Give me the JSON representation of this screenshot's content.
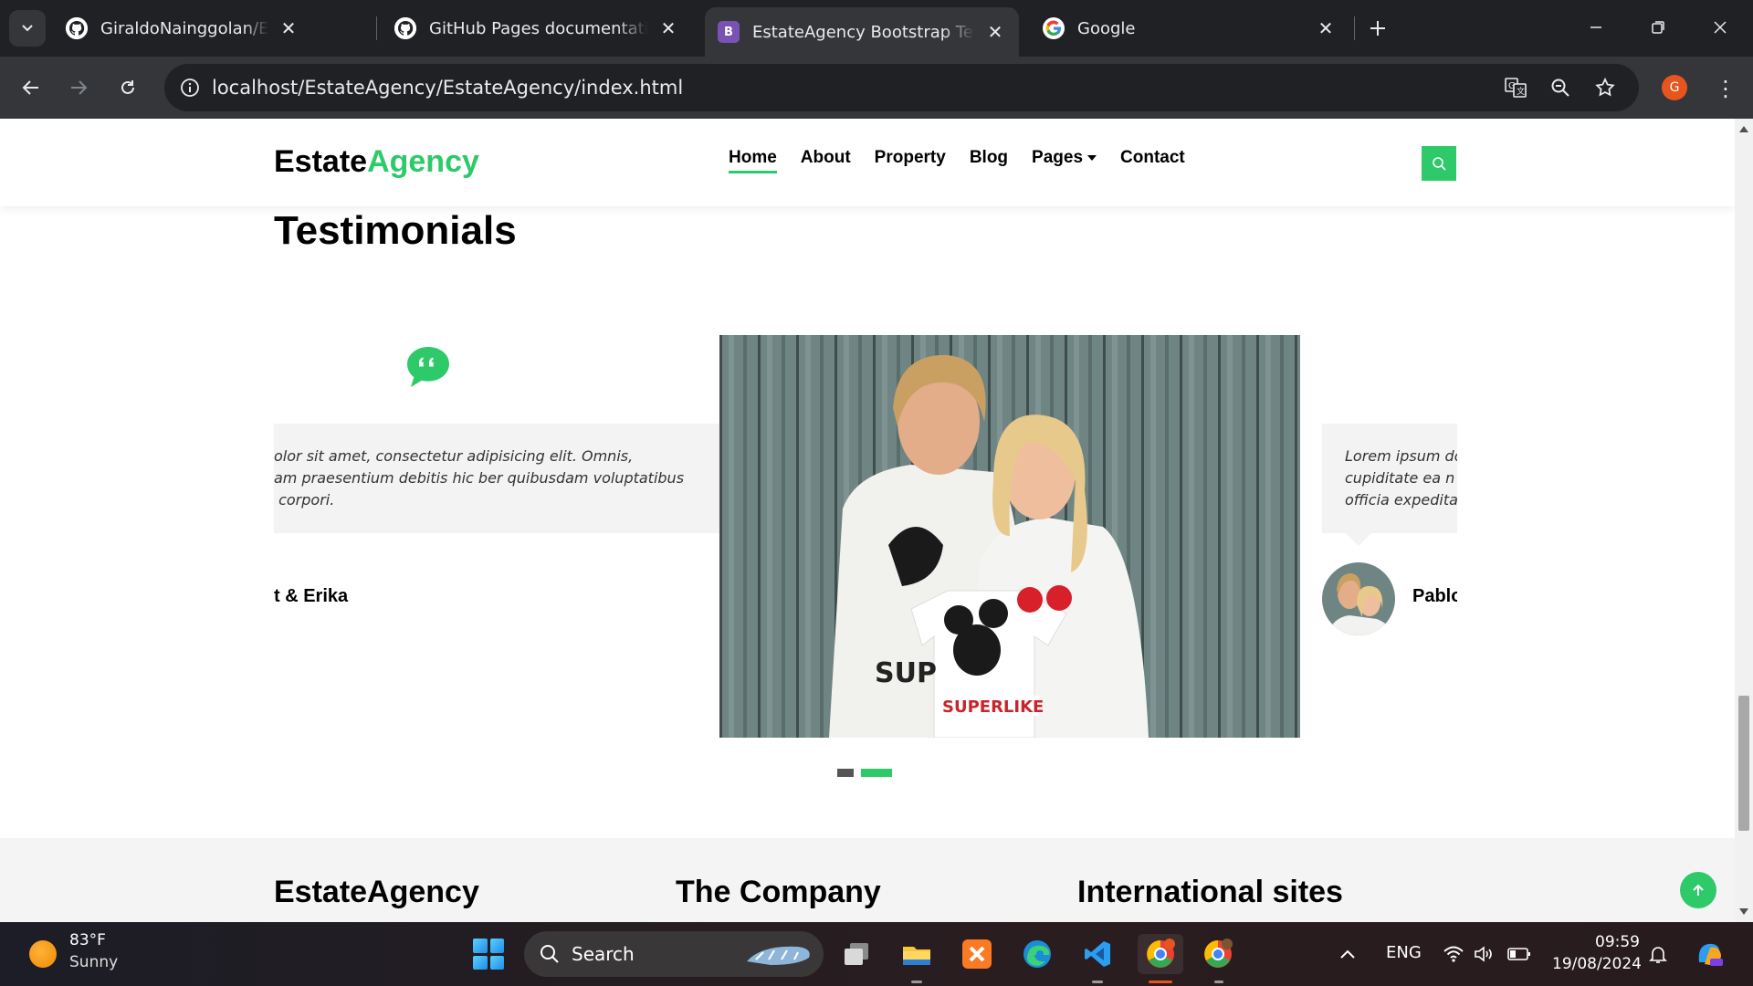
{
  "browser": {
    "tabs": [
      {
        "title": "GiraldoNainggolan/EstateAgency",
        "favicon": "github-icon",
        "active": false
      },
      {
        "title": "GitHub Pages documentation - GitHub Docs",
        "favicon": "github-icon",
        "active": false
      },
      {
        "title": "EstateAgency Bootstrap Template",
        "favicon": "bootstrap-icon",
        "active": true
      },
      {
        "title": "Google",
        "favicon": "google-icon",
        "active": false
      }
    ],
    "url": "localhost/EstateAgency/EstateAgency/index.html",
    "profile_initial": "G"
  },
  "site": {
    "logo": {
      "part1": "Estate",
      "part2": "Agency"
    },
    "accent_color": "#2eca6a",
    "nav": [
      "Home",
      "About",
      "Property",
      "Blog",
      "Pages",
      "Contact"
    ],
    "active_nav": "Home"
  },
  "testimonials": {
    "title": "Testimonials",
    "left_text": "olor sit amet, consectetur adipisicing elit. Omnis,\nam praesentium debitis hic ber quibusdam voluptatibus\n corpori.",
    "left_author": "t & Erika",
    "right_text": "Lorem ipsum do\ncupiditate ea n\nofficia expedita",
    "right_author": "Pablo",
    "active_slide": 1,
    "slide_count": 2
  },
  "footer": {
    "headings": [
      "EstateAgency",
      "The Company",
      "International sites"
    ]
  },
  "taskbar": {
    "temperature": "83°F",
    "condition": "Sunny",
    "search_label": "Search",
    "language": "ENG",
    "time": "09:59",
    "date": "19/08/2024"
  }
}
